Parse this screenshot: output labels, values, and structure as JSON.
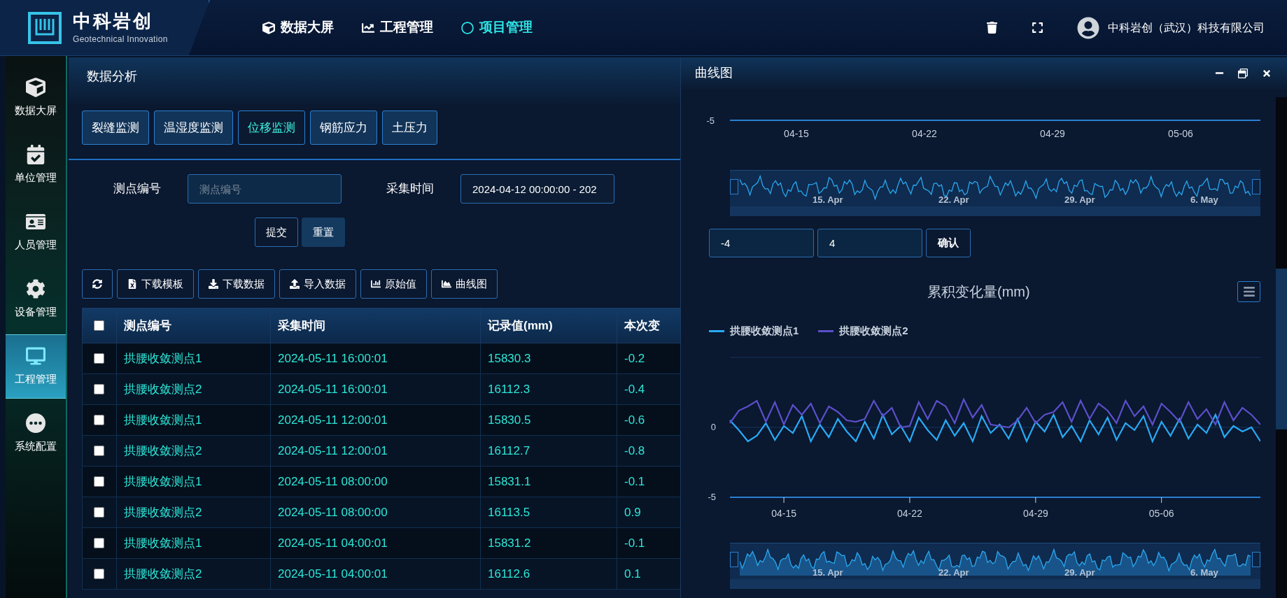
{
  "brand": {
    "name": "中科岩创",
    "subtitle": "Geotechnical Innovation"
  },
  "top_nav": [
    {
      "label": "数据大屏",
      "kind": "cube",
      "selected": false
    },
    {
      "label": "工程管理",
      "kind": "chart",
      "selected": false
    },
    {
      "label": "项目管理",
      "kind": "circle",
      "selected": true
    }
  ],
  "user": {
    "company": "中科岩创（武汉）科技有限公司"
  },
  "sidebar": {
    "items": [
      {
        "label": "数据大屏",
        "kind": "cube",
        "selected": false
      },
      {
        "label": "单位管理",
        "kind": "calendar",
        "selected": false
      },
      {
        "label": "人员管理",
        "kind": "person",
        "selected": false
      },
      {
        "label": "设备管理",
        "kind": "gear",
        "selected": false
      },
      {
        "label": "工程管理",
        "kind": "monitor",
        "selected": true
      },
      {
        "label": "系统配置",
        "kind": "dots",
        "selected": false
      }
    ]
  },
  "panel": {
    "title": "数据分析",
    "category_tabs": [
      {
        "label": "裂缝监测",
        "selected": false
      },
      {
        "label": "温湿度监测",
        "selected": false
      },
      {
        "label": "位移监测",
        "selected": true
      },
      {
        "label": "钢筋应力",
        "selected": false
      },
      {
        "label": "土压力",
        "selected": false
      }
    ],
    "filters": [
      {
        "label": "测点编号",
        "placeholder": "测点编号"
      },
      {
        "label": "采集时间",
        "value": "2024-04-12 00:00:00 - 202"
      }
    ],
    "form_buttons": [
      {
        "label": "提交",
        "kind": "outline"
      },
      {
        "label": "重置",
        "kind": "filled"
      }
    ],
    "toolbar": [
      {
        "kind": "refresh"
      },
      {
        "kind": "excel",
        "label": "下载模板"
      },
      {
        "kind": "download",
        "label": "下载数据"
      },
      {
        "kind": "upload",
        "label": "导入数据"
      },
      {
        "kind": "bars",
        "label": "原始值"
      },
      {
        "kind": "area",
        "label": "曲线图"
      }
    ],
    "table": {
      "select_all": {
        "checked": false
      },
      "columns": [
        "测点编号",
        "采集时间",
        "记录值(mm)",
        "本次变"
      ],
      "rows": [
        {
          "checked": false,
          "cells": [
            "拱腰收敛测点1",
            "2024-05-11 16:00:01",
            "15830.3",
            "-0.2"
          ]
        },
        {
          "checked": false,
          "cells": [
            "拱腰收敛测点2",
            "2024-05-11 16:00:01",
            "16112.3",
            "-0.4"
          ]
        },
        {
          "checked": false,
          "cells": [
            "拱腰收敛测点1",
            "2024-05-11 12:00:01",
            "15830.5",
            "-0.6"
          ]
        },
        {
          "checked": false,
          "cells": [
            "拱腰收敛测点2",
            "2024-05-11 12:00:01",
            "16112.7",
            "-0.8"
          ]
        },
        {
          "checked": false,
          "cells": [
            "拱腰收敛测点1",
            "2024-05-11 08:00:00",
            "15831.1",
            "-0.1"
          ]
        },
        {
          "checked": false,
          "cells": [
            "拱腰收敛测点2",
            "2024-05-11 08:00:00",
            "16113.5",
            "0.9"
          ]
        },
        {
          "checked": false,
          "cells": [
            "拱腰收敛测点1",
            "2024-05-11 04:00:01",
            "15831.2",
            "-0.1"
          ]
        },
        {
          "checked": false,
          "cells": [
            "拱腰收敛测点2",
            "2024-05-11 04:00:01",
            "16112.6",
            "0.1"
          ]
        }
      ]
    }
  },
  "dialog": {
    "title": "曲线图",
    "upper_chart": {
      "ytick": "-5",
      "xticks": [
        "04-15",
        "04-22",
        "04-29",
        "05-06"
      ],
      "navigator_labels": [
        "15. Apr",
        "22. Apr",
        "29. Apr",
        "6. May"
      ]
    },
    "range": {
      "min": "-4",
      "max": "4",
      "confirm": "确认"
    },
    "chart": {
      "navigator_labels": [
        "15. Apr",
        "22. Apr",
        "29. Apr",
        "6. May"
      ],
      "chart_data": {
        "type": "line",
        "title": "累积变化量(mm)",
        "categories": [
          null,
          null,
          null,
          null,
          null,
          null,
          "04-15",
          null,
          null,
          null,
          null,
          null,
          null,
          null,
          null,
          null,
          null,
          null,
          null,
          null,
          "04-22",
          null,
          null,
          null,
          null,
          null,
          null,
          null,
          null,
          null,
          null,
          null,
          null,
          null,
          "04-29",
          null,
          null,
          null,
          null,
          null,
          null,
          null,
          null,
          null,
          null,
          null,
          null,
          null,
          "05-06",
          null,
          null,
          null,
          null,
          null,
          null,
          null,
          null,
          null,
          null,
          null
        ],
        "series": [
          {
            "name": "拱腰收敛测点1",
            "color": "#29aaf5",
            "values": [
              0.5,
              -0.2,
              -1,
              -0.6,
              0.3,
              -0.9,
              0.1,
              -0.4,
              0.8,
              -1,
              0.2,
              -0.7,
              0.6,
              -0.3,
              -1,
              0.4,
              -0.8,
              0.9,
              -0.5,
              0.1,
              -1,
              0.7,
              -0.2,
              -0.9,
              0.5,
              -0.6,
              0.3,
              -1,
              0.8,
              -0.4,
              0.2,
              -0.8,
              0.6,
              -1,
              0.4,
              -0.3,
              0.9,
              -0.7,
              0.1,
              -1,
              0.5,
              -0.5,
              0.7,
              -0.9,
              0.3,
              -0.2,
              0.8,
              -1,
              0.4,
              -0.6,
              0.6,
              -0.8,
              0.2,
              -0.4,
              0.9,
              -0.7,
              0.1,
              -0.3,
              0,
              -1
            ]
          },
          {
            "name": "拱腰收敛测点2",
            "color": "#5b4fc9",
            "values": [
              0.3,
              1.2,
              1.5,
              1.9,
              0.4,
              1.8,
              0.2,
              1.6,
              0.9,
              1.7,
              0.3,
              1.5,
              1.1,
              0.5,
              0.4,
              0.6,
              1.9,
              0.8,
              1.4,
              0,
              0.1,
              1.8,
              0.6,
              1.9,
              1.5,
              0.3,
              2,
              0.7,
              1.6,
              0.2,
              0.1,
              0,
              0.5,
              1.4,
              0.3,
              0.9,
              1.1,
              1.8,
              0.4,
              1.9,
              0.6,
              1.7,
              1.2,
              0.3,
              1.9,
              0.8,
              1.5,
              0.2,
              1.7,
              1.1,
              0.4,
              1.8,
              0.6,
              1.3,
              0.2,
              1.8,
              0.5,
              1.4,
              0.9,
              0.2
            ]
          }
        ],
        "ylim": [
          -5,
          5
        ],
        "yticks": [
          -5,
          0
        ]
      }
    }
  }
}
